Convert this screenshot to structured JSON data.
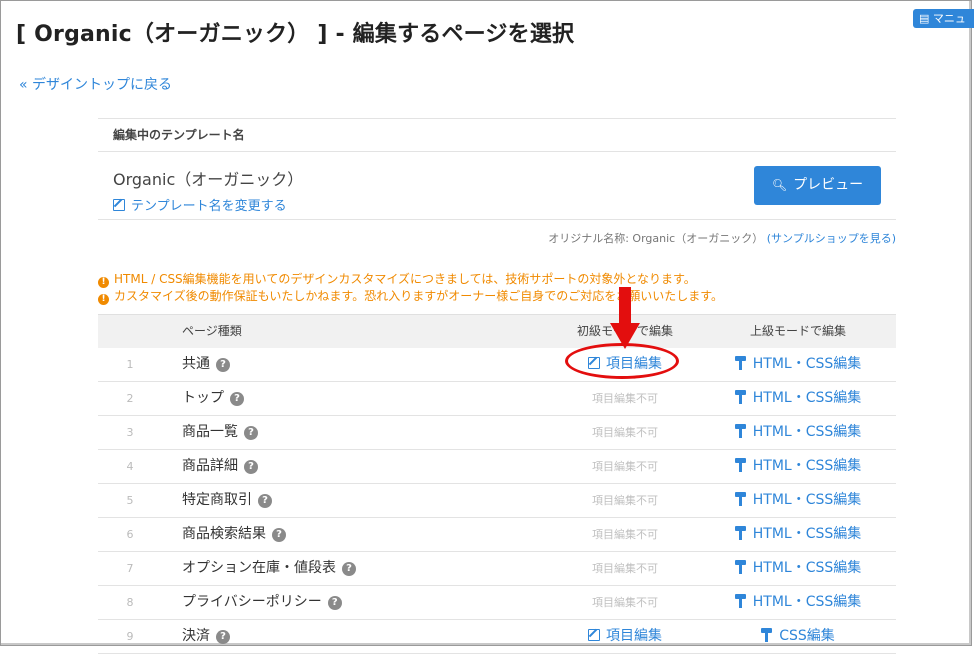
{
  "page": {
    "title": "[ Organic（オーガニック） ] - 編集するページを選択",
    "manual_label": "マニュ",
    "back_link": "« デザイントップに戻る"
  },
  "template": {
    "section_label": "編集中のテンプレート名",
    "name": "Organic（オーガニック）",
    "rename_link": "テンプレート名を変更する",
    "preview_button": "プレビュー",
    "original_name": "オリジナル名称: Organic（オーガニック）",
    "sample_shop_link": "(サンプルショップを見る)"
  },
  "warnings": [
    "HTML / CSS編集機能を用いてのデザインカスタマイズにつきましては、技術サポートの対象外となります。",
    "カスタマイズ後の動作保証もいたしかねます。恐れ入りますがオーナー様ご自身でのご対応をお願いいたします。"
  ],
  "table": {
    "headers": {
      "page_type": "ページ種類",
      "basic": "初級モードで編集",
      "advanced": "上級モードで編集"
    },
    "rows": [
      {
        "num": "1",
        "name": "共通",
        "basic": "項目編集",
        "basic_enabled": true,
        "advanced": "HTML・CSS編集"
      },
      {
        "num": "2",
        "name": "トップ",
        "basic": "項目編集不可",
        "basic_enabled": false,
        "advanced": "HTML・CSS編集"
      },
      {
        "num": "3",
        "name": "商品一覧",
        "basic": "項目編集不可",
        "basic_enabled": false,
        "advanced": "HTML・CSS編集"
      },
      {
        "num": "4",
        "name": "商品詳細",
        "basic": "項目編集不可",
        "basic_enabled": false,
        "advanced": "HTML・CSS編集"
      },
      {
        "num": "5",
        "name": "特定商取引",
        "basic": "項目編集不可",
        "basic_enabled": false,
        "advanced": "HTML・CSS編集"
      },
      {
        "num": "6",
        "name": "商品検索結果",
        "basic": "項目編集不可",
        "basic_enabled": false,
        "advanced": "HTML・CSS編集"
      },
      {
        "num": "7",
        "name": "オプション在庫・値段表",
        "basic": "項目編集不可",
        "basic_enabled": false,
        "advanced": "HTML・CSS編集"
      },
      {
        "num": "8",
        "name": "プライバシーポリシー",
        "basic": "項目編集不可",
        "basic_enabled": false,
        "advanced": "HTML・CSS編集"
      },
      {
        "num": "9",
        "name": "決済",
        "basic": "項目編集",
        "basic_enabled": true,
        "advanced": "CSS編集"
      }
    ]
  },
  "colors": {
    "link": "#2f86d9",
    "warning": "#f08a00",
    "annotation": "#e30e0e"
  },
  "icons": {
    "help": "question-circle-icon",
    "edit": "edit-icon",
    "roller": "paint-roller-icon",
    "search": "search-icon",
    "warning": "exclamation-circle-icon",
    "document": "document-icon"
  }
}
